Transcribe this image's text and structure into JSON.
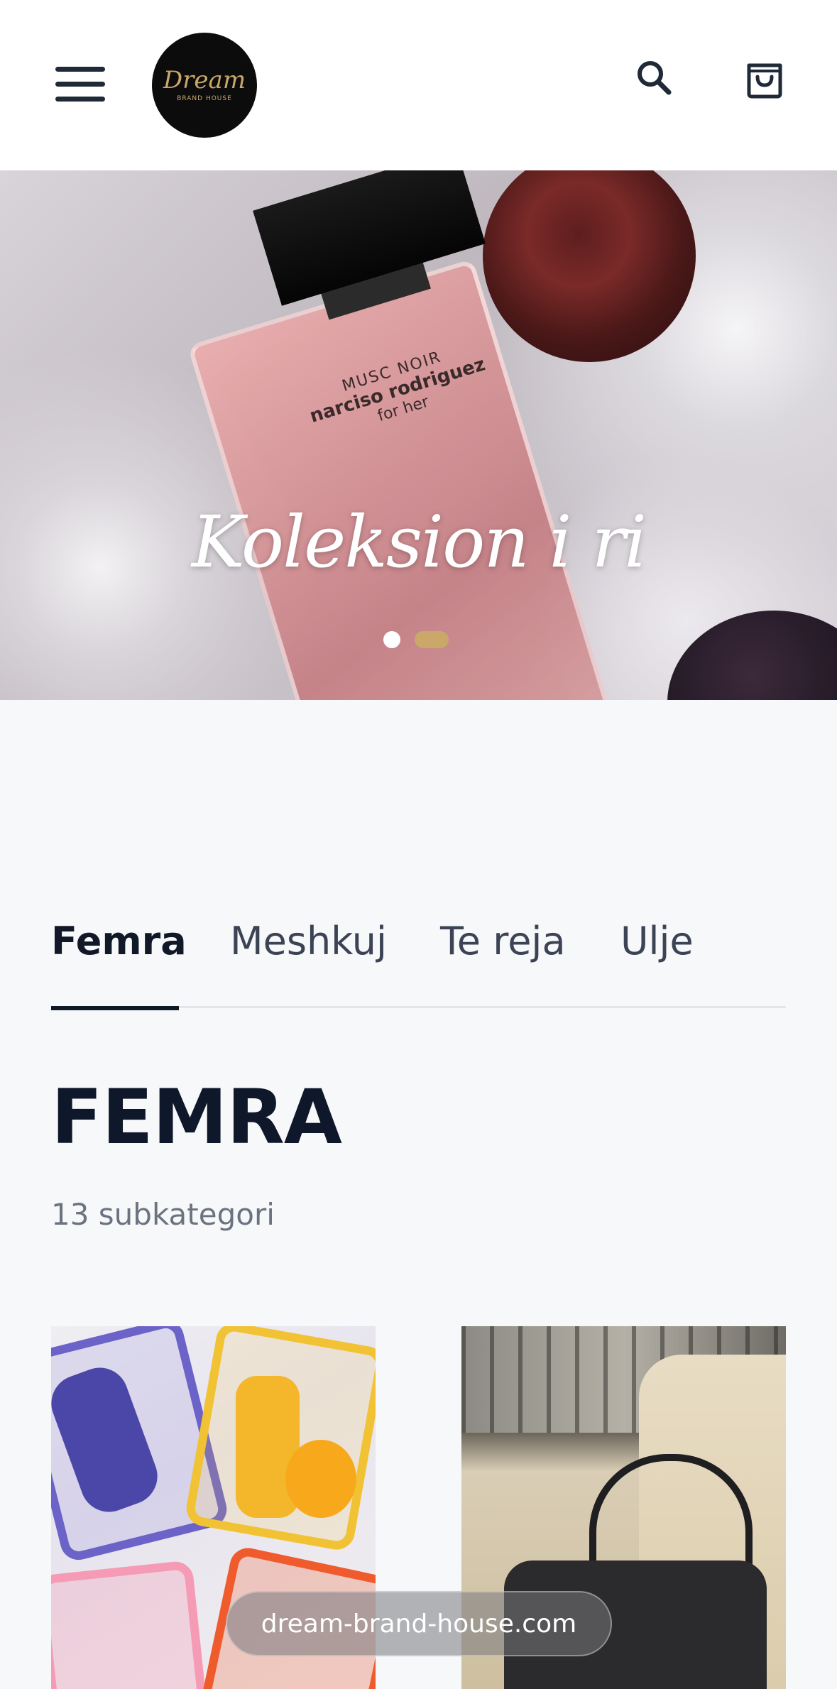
{
  "header": {
    "logo_text": "Dream",
    "logo_subtext": "BRAND HOUSE",
    "menu_icon": "hamburger-icon",
    "search_icon": "search-icon",
    "cart_icon": "shopping-bag-icon"
  },
  "hero": {
    "title": "Koleksion i ri",
    "product_label": {
      "line1": "MUSC NOIR",
      "line2": "narciso rodriguez",
      "line3": "for her"
    },
    "slides_total": 2,
    "active_slide": 2
  },
  "tabs": [
    {
      "label": "Femra",
      "active": true
    },
    {
      "label": "Meshkuj",
      "active": false
    },
    {
      "label": "Te reja",
      "active": false
    },
    {
      "label": "Ulje",
      "active": false
    }
  ],
  "category": {
    "title": "FEMRA",
    "subtitle": "13 subkategori"
  },
  "browser": {
    "url": "dream-brand-house.com"
  },
  "colors": {
    "accent": "#c9a86a",
    "text_dark": "#0f172a",
    "background": "#f7f8fa"
  }
}
